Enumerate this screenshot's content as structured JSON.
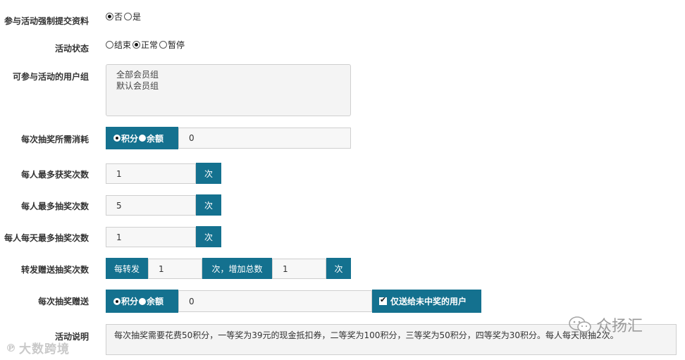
{
  "fields": {
    "force_submit": {
      "label": "参与活动强制提交资料",
      "options": [
        "否",
        "是"
      ],
      "selected": "否"
    },
    "status": {
      "label": "活动状态",
      "options": [
        "结束",
        "正常",
        "暂停"
      ],
      "selected": "正常"
    },
    "user_groups": {
      "label": "可参与活动的用户组",
      "items": [
        "全部会员组",
        "默认会员组"
      ]
    },
    "cost_per_draw": {
      "label": "每次抽奖所需消耗",
      "options": [
        "积分",
        "余额"
      ],
      "selected": "积分",
      "value": "0"
    },
    "max_wins": {
      "label": "每人最多获奖次数",
      "value": "1",
      "unit": "次"
    },
    "max_draws": {
      "label": "每人最多抽奖次数",
      "value": "5",
      "unit": "次"
    },
    "max_daily_draws": {
      "label": "每人每天最多抽奖次数",
      "value": "1",
      "unit": "次"
    },
    "share_gift": {
      "label": "转发赠送抽奖次数",
      "prefix": "每转发",
      "value1": "1",
      "middle": "次，增加总数",
      "value2": "1",
      "unit": "次"
    },
    "gift_per_draw": {
      "label": "每次抽奖赠送",
      "options": [
        "积分",
        "余额"
      ],
      "selected": "积分",
      "value": "0",
      "checkbox_label": "仅送给未中奖的用户",
      "checkbox_checked": true
    },
    "description": {
      "label": "活动说明",
      "text": "每次抽奖需要花费50积分，一等奖为39元的现金抵扣券，二等奖为100积分，三等奖为50积分，四等奖为30积分。每人每天限抽2次。"
    }
  },
  "watermarks": {
    "left": "大数跨境",
    "right": "众扬汇"
  },
  "colors": {
    "accent": "#14718f",
    "field_bg": "#f7f7f7",
    "border": "#cfcfcf"
  }
}
